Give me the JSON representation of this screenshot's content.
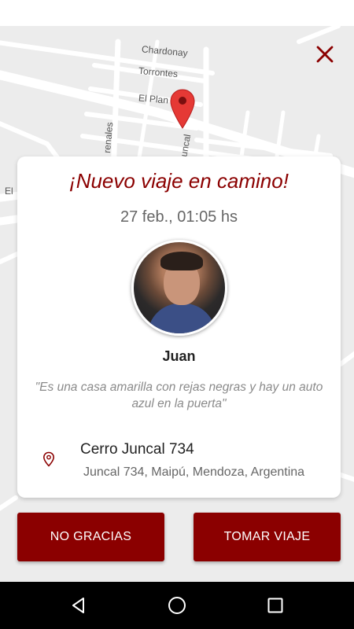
{
  "map": {
    "streets": [
      "Chardonay",
      "Torrontes",
      "El Plan",
      "Juncal",
      "renales",
      "El"
    ]
  },
  "close": {
    "icon": "close-icon",
    "color": "#8b0000"
  },
  "card": {
    "title": "¡Nuevo viaje en camino!",
    "date": "27 feb., 01:05 hs",
    "passenger_name": "Juan",
    "note": "\"Es una casa amarilla con rejas negras y hay un auto azul en la puerta\"",
    "address_main": "Cerro Juncal 734",
    "address_sub": "Juncal 734, Maipú, Mendoza, Argentina"
  },
  "buttons": {
    "decline_label": "NO GRACIAS",
    "accept_label": "TOMAR VIAJE"
  },
  "colors": {
    "accent": "#8b0000",
    "pin": "#e53935"
  }
}
